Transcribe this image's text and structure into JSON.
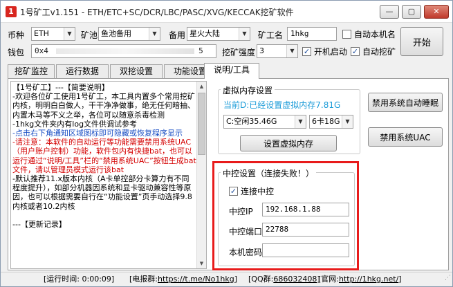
{
  "window": {
    "title": "1号矿工v1.151 - ETH/ETC+SC/DCR/LBC/PASC/XVG/KECCAK挖矿软件",
    "app_icon": "1",
    "controls": {
      "minimize": "—",
      "maximize": "▢",
      "close": "✕"
    }
  },
  "row1": {
    "coin_label": "币种",
    "coin_value": "ETH",
    "pool_label": "矿池",
    "pool_value": "鱼池备用",
    "backup_label": "备用",
    "backup_value": "星火大陆",
    "worker_label": "矿工名",
    "worker_value": "1hkg",
    "auto_name_label": "自动本机名"
  },
  "row2": {
    "wallet_label": "钱包",
    "wallet_value": "0x4",
    "wallet_tail": "5",
    "intensity_label": "挖矿强度",
    "intensity_value": "3",
    "autostart_label": "开机启动",
    "autostart_checked": "✓",
    "automine_label": "自动挖矿",
    "automine_checked": "✓"
  },
  "start_button": "开始",
  "tabs": [
    {
      "label": "挖矿监控"
    },
    {
      "label": "运行数据"
    },
    {
      "label": "双挖设置"
    },
    {
      "label": "功能设置"
    },
    {
      "label": "说明/工具"
    }
  ],
  "notes": {
    "p1": "【1号矿工】---【简要说明】",
    "p2": "-欢迎各位矿工使用1号矿工，本工具内置多个常用挖矿内核，明明白白做人，干干净净做事，绝无任何暗抽、内置木马等不义之举，各位可以随意杀毒检测",
    "p3": "-1hkg文件夹内有log文件供调试参考",
    "p4": "-点击右下角通知区域图标即可隐藏或恢复程序显示",
    "p5": "-请注意：本软件的自动运行等功能需要禁用系统UAC（用户账户控制）功能，软件包内有快捷bat，也可以运行通过“说明/工具”栏的“禁用系统UAC”按钮生成bat文件，请以管理员模式运行该bat",
    "p6": "-默认推荐11.x版本内核（A卡单控部分卡算力有不同程度提升），如部分机器因系统和显卡驱动兼容性等原因，也可以根据需要自行在“功能设置”页手动选择9.8内核或者10.2内核",
    "p7": "---【更新记录】"
  },
  "vmem": {
    "title": "虚拟内存设置",
    "status": "当前D:已经设置虚拟内存7.81G",
    "drive_value": "C:空闲35.46G",
    "cards_value": "6卡18G",
    "set_button": "设置虚拟内存"
  },
  "tools": {
    "disable_sleep": "禁用系统自动睡眠",
    "disable_uac": "禁用系统UAC"
  },
  "central": {
    "title": "中控设置（连接失败！）",
    "connect_label": "连接中控",
    "connect_checked": "✓",
    "ip_label": "中控IP",
    "ip_value": "192.168.1.88",
    "port_label": "中控端口",
    "port_value": "22788",
    "password_label": "本机密码",
    "password_value": ""
  },
  "status": {
    "runtime": "[运行时间: 0:00:09]",
    "tg_prefix": "[电报群:",
    "tg_link": "https://t.me/No1hkg",
    "tg_suffix": "]",
    "qq_prefix": "[QQ群:",
    "qq_link": "686032408",
    "qq_suffix": "]",
    "site_prefix": "[官网:",
    "site_link": "http://1hkg.net/",
    "site_suffix": "]"
  }
}
